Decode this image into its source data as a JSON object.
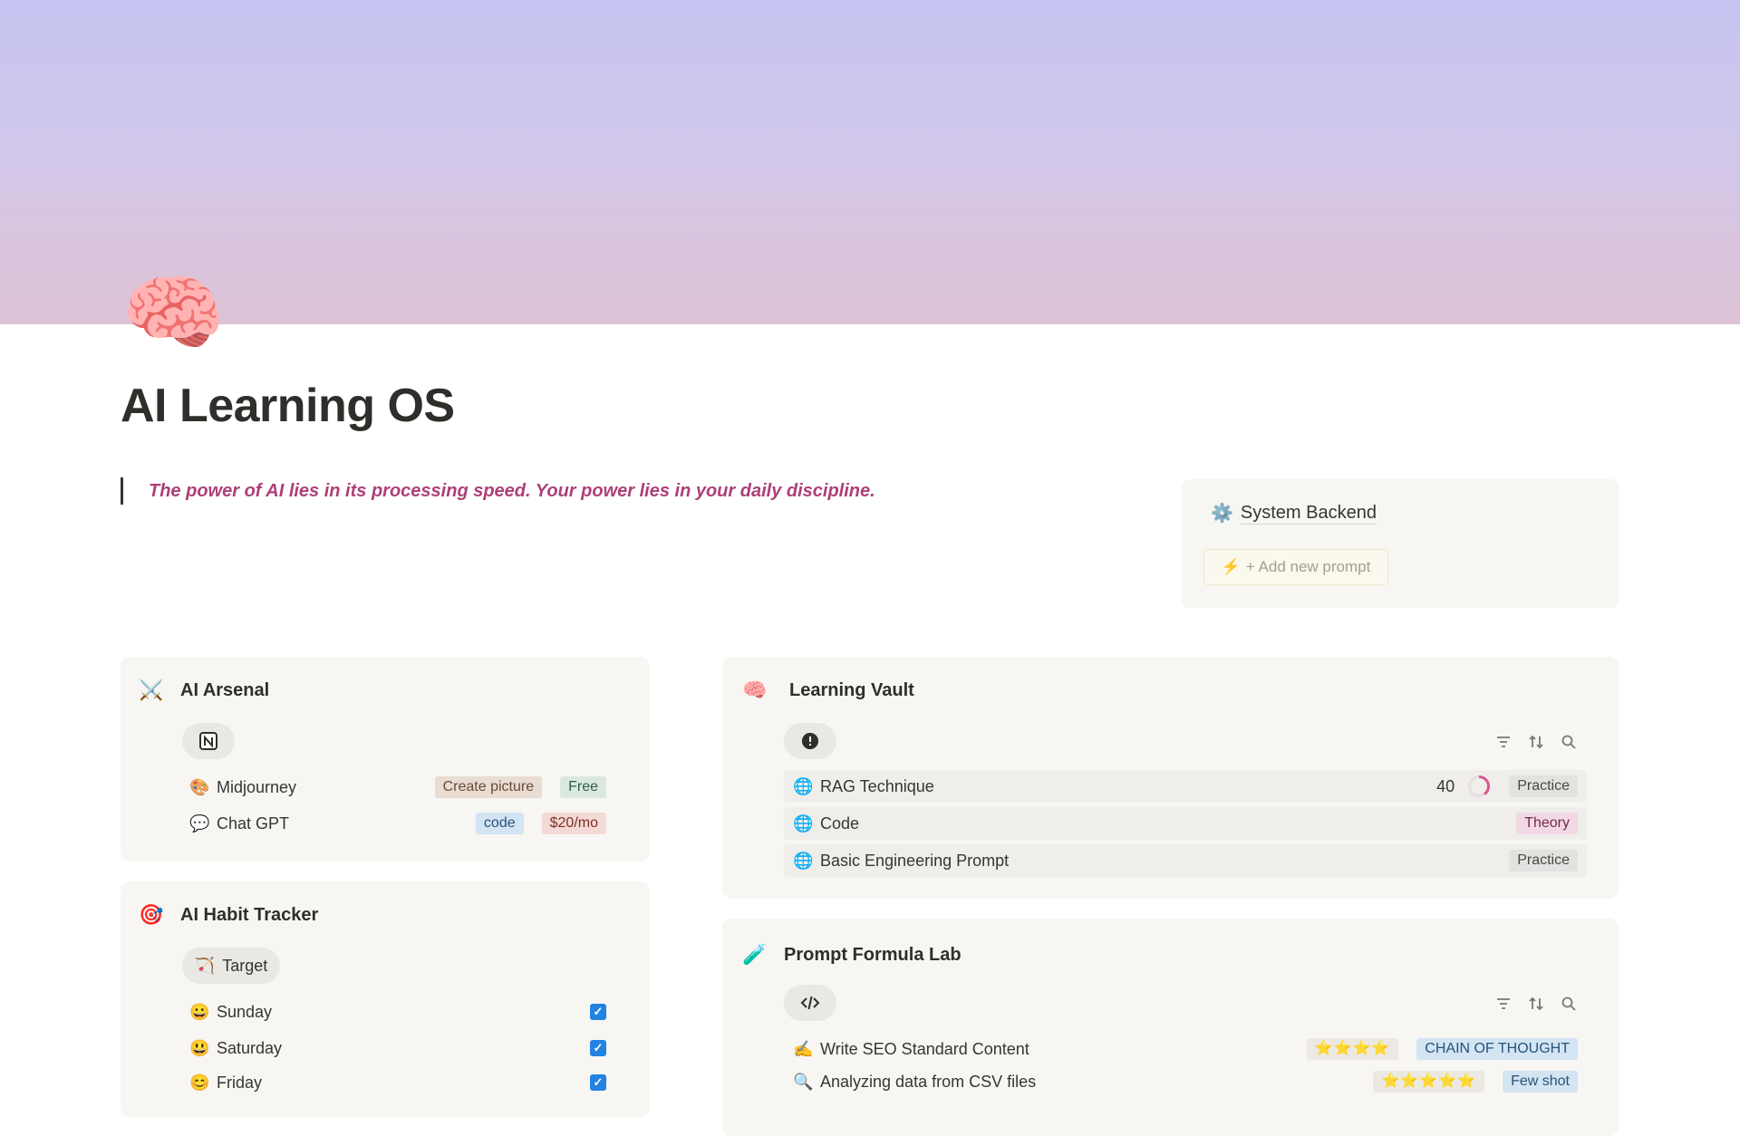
{
  "page": {
    "icon": "🧠",
    "title": "AI Learning OS",
    "quote": "The power of AI lies in its processing speed. Your power lies in your daily discipline."
  },
  "backend": {
    "icon": "⚙️",
    "link_label": "System Backend",
    "add_icon": "⚡",
    "add_label": "+ Add new prompt"
  },
  "arsenal": {
    "icon": "⚔️",
    "title": "AI Arsenal",
    "view_icon": "notion-icon",
    "items": [
      {
        "emoji": "🎨",
        "name": "Midjourney",
        "tags": [
          "Create picture",
          "Free"
        ]
      },
      {
        "emoji": "💬",
        "name": "Chat GPT",
        "tags": [
          "code",
          "$20/mo"
        ]
      }
    ]
  },
  "habit": {
    "icon": "🎯",
    "title": "AI Habit Tracker",
    "view_icon": "🏹",
    "view_label": "Target",
    "items": [
      {
        "emoji": "😀",
        "name": "Sunday",
        "checked": true
      },
      {
        "emoji": "😃",
        "name": "Saturday",
        "checked": true
      },
      {
        "emoji": "😊",
        "name": "Friday",
        "checked": true
      }
    ]
  },
  "vault": {
    "icon": "🧠",
    "title": "Learning Vault",
    "view_icon": "alert-bubble-icon",
    "items": [
      {
        "emoji": "🌐",
        "name": "RAG Technique",
        "count": "40",
        "progress": 0.4,
        "tag": "Practice"
      },
      {
        "emoji": "🌐",
        "name": "Code",
        "tag": "Theory"
      },
      {
        "emoji": "🌐",
        "name": "Basic Engineering Prompt",
        "tag": "Practice"
      }
    ]
  },
  "lab": {
    "icon": "🧪",
    "title": "Prompt Formula Lab",
    "view_icon": "code-icon",
    "items": [
      {
        "emoji": "✍️",
        "name": "Write SEO Standard Content",
        "stars": "⭐⭐⭐⭐",
        "tag": "CHAIN OF THOUGHT"
      },
      {
        "emoji": "🔍",
        "name": "Analyzing data from CSV files",
        "stars": "⭐⭐⭐⭐⭐",
        "tag": "Few shot"
      }
    ]
  },
  "colors": {
    "accent": "#2383e2",
    "quote": "#ad3f77"
  }
}
